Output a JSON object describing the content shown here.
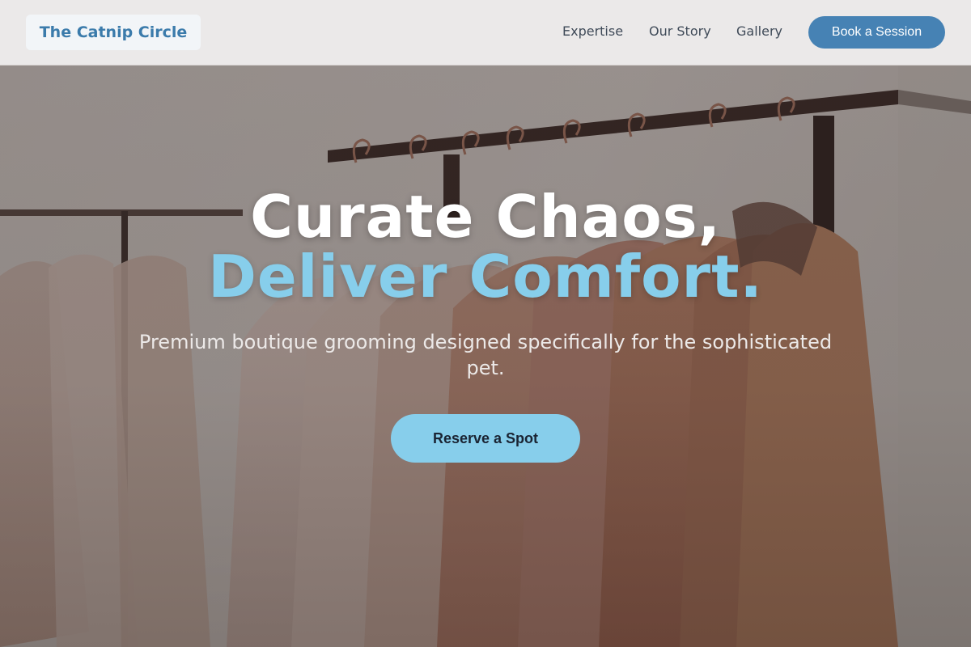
{
  "header": {
    "brand": "The Catnip Circle",
    "nav": [
      {
        "label": "Expertise"
      },
      {
        "label": "Our Story"
      },
      {
        "label": "Gallery"
      }
    ],
    "cta": "Book a Session"
  },
  "hero": {
    "title_line1": "Curate Chaos,",
    "title_line2": "Deliver Comfort.",
    "subtitle": "Premium boutique grooming designed specifically for the sophisticated pet.",
    "button": "Reserve a Spot",
    "accent_color": "#87ceeb",
    "background_icon": "clothing-rack-photo"
  },
  "colors": {
    "brand": "#4682b4",
    "accent": "#87ceeb",
    "header_bg": "#ebe9e9"
  }
}
